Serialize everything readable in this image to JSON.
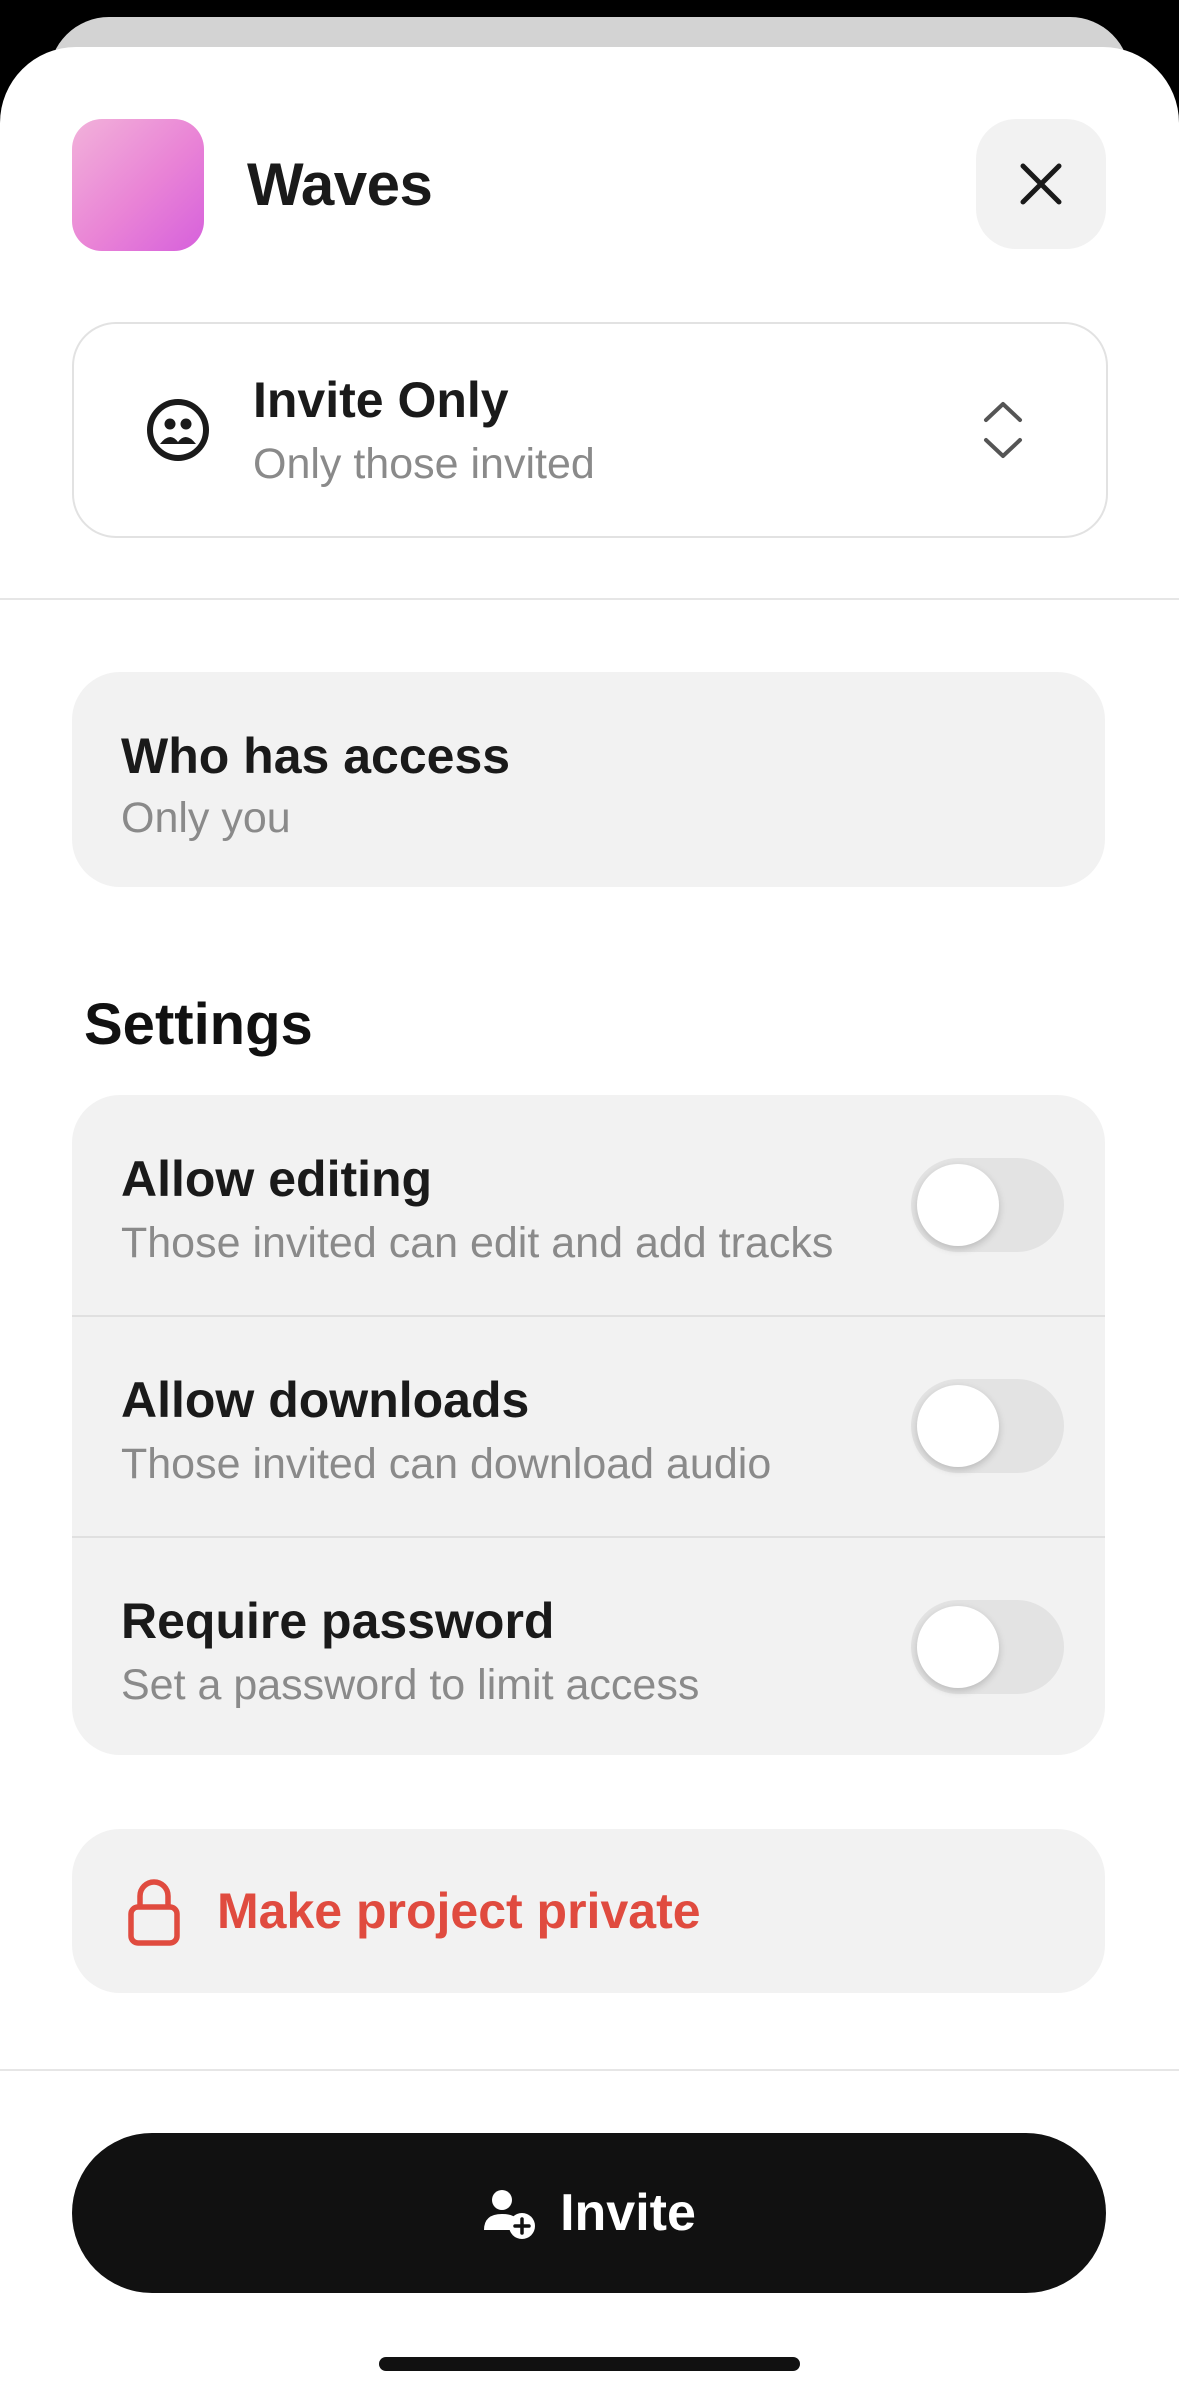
{
  "header": {
    "app_name": "Waves",
    "close_icon": "close-icon"
  },
  "access": {
    "title": "Invite Only",
    "subtitle": "Only those invited",
    "icon": "group-icon",
    "chevron": "chevron-up-down-icon"
  },
  "who_has_access": {
    "title": "Who has access",
    "value": "Only you"
  },
  "settings": {
    "heading": "Settings",
    "items": [
      {
        "title": "Allow editing",
        "subtitle": "Those invited can edit and add tracks",
        "enabled": false
      },
      {
        "title": "Allow downloads",
        "subtitle": "Those invited can download audio",
        "enabled": false
      },
      {
        "title": "Require password",
        "subtitle": "Set a password to limit access",
        "enabled": false
      }
    ]
  },
  "private": {
    "label": "Make project private",
    "icon": "lock-icon"
  },
  "invite": {
    "label": "Invite",
    "icon": "add-user-icon"
  },
  "colors": {
    "danger": "#e04b3f",
    "primary_button": "#111111",
    "card_bg": "#f2f2f2",
    "app_icon_gradient": [
      "#f2b2da",
      "#d660dc"
    ]
  }
}
